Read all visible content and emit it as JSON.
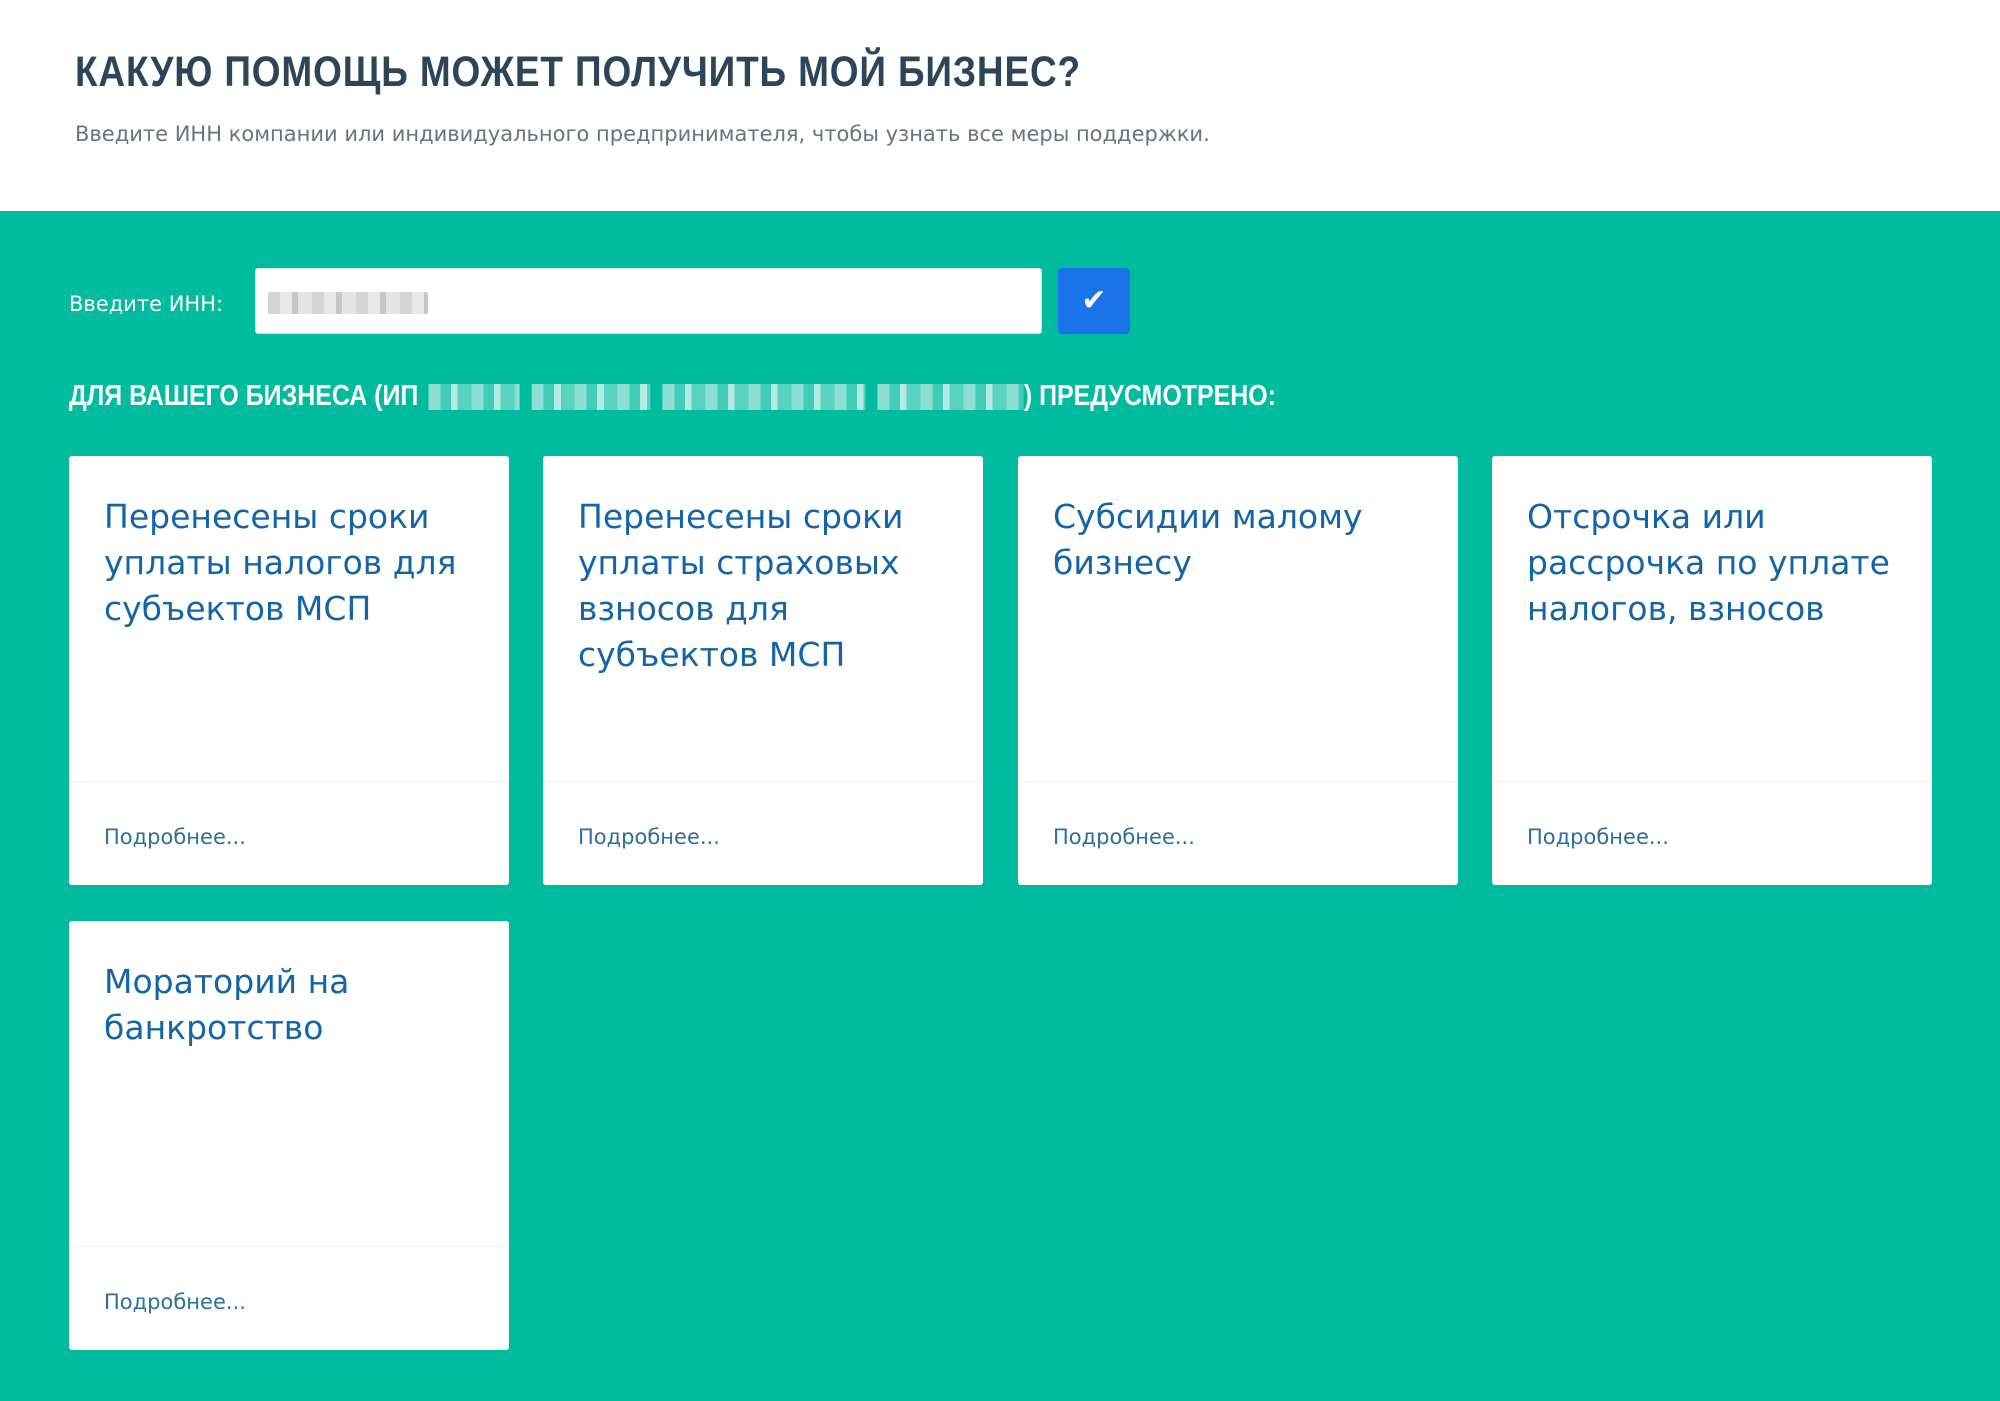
{
  "header": {
    "title": "КАКУЮ ПОМОЩЬ МОЖЕТ ПОЛУЧИТЬ МОЙ БИЗНЕС?",
    "subtitle": "Введите ИНН компании или индивидуального предпринимателя, чтобы узнать все меры поддержки."
  },
  "form": {
    "inn_label": "Введите ИНН:",
    "inn_value": "",
    "submit_icon": "check-icon",
    "submit_glyph": "✔"
  },
  "result": {
    "heading_prefix": "ДЛЯ ВАШЕГО БИЗНЕСА (ИП",
    "heading_suffix": ") ПРЕДУСМОТРЕНО:"
  },
  "cards": [
    {
      "title": "Перенесены сроки уплаты налогов для субъектов МСП",
      "link": "Подробнее..."
    },
    {
      "title": "Перенесены сроки уплаты страховых взносов для субъектов МСП",
      "link": "Подробнее..."
    },
    {
      "title": "Субсидии малому бизнесу",
      "link": "Подробнее..."
    },
    {
      "title": "Отсрочка или рассрочка по уплате налогов, взносов",
      "link": "Подробнее..."
    },
    {
      "title": "Мораторий на банкротство",
      "link": "Подробнее..."
    }
  ],
  "colors": {
    "background": "#00bb9e",
    "title": "#2c4558",
    "card_title": "#1565a6",
    "button": "#1a73e8"
  }
}
